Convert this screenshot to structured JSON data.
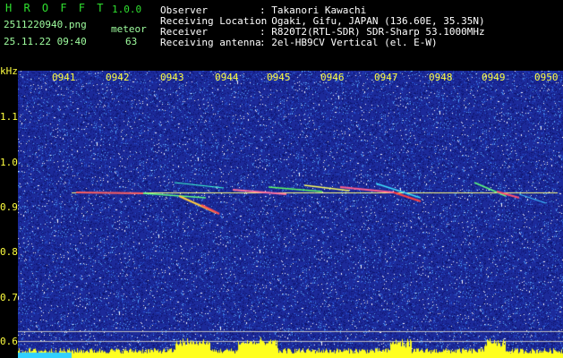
{
  "header": {
    "app_name": "H R O F F T",
    "version": "1.0.0",
    "file_name": "2511220940.png",
    "date_time": "25.11.22 09:40",
    "meteor_label": "meteor",
    "meteor_count": "63",
    "info_labels": [
      "Observer",
      "Receiving Location",
      "Receiver",
      "Receiving antenna"
    ],
    "info_values": [
      ": Takanori Kawachi",
      ": Ogaki, Gifu, JAPAN (136.60E, 35.35N)",
      ": R820T2(RTL-SDR) SDR-Sharp 53.1000MHz",
      ": 2el-HB9CV Vertical (el. E-W)"
    ]
  },
  "axis": {
    "unit": "kHz",
    "time_ticks": [
      "0941",
      "0942",
      "0943",
      "0944",
      "0945",
      "0946",
      "0947",
      "0948",
      "0949",
      "0950"
    ],
    "freq_ticks": [
      "1.1",
      "1.0",
      "0.9",
      "0.8",
      "0.7",
      "0.6"
    ]
  },
  "colors": {
    "background_noise": "#1c2a9a",
    "reference_line": "#ffff80",
    "level_fill": "#ffff20",
    "header_green": "#2fe02f",
    "label_yellow": "#ffff40"
  }
}
